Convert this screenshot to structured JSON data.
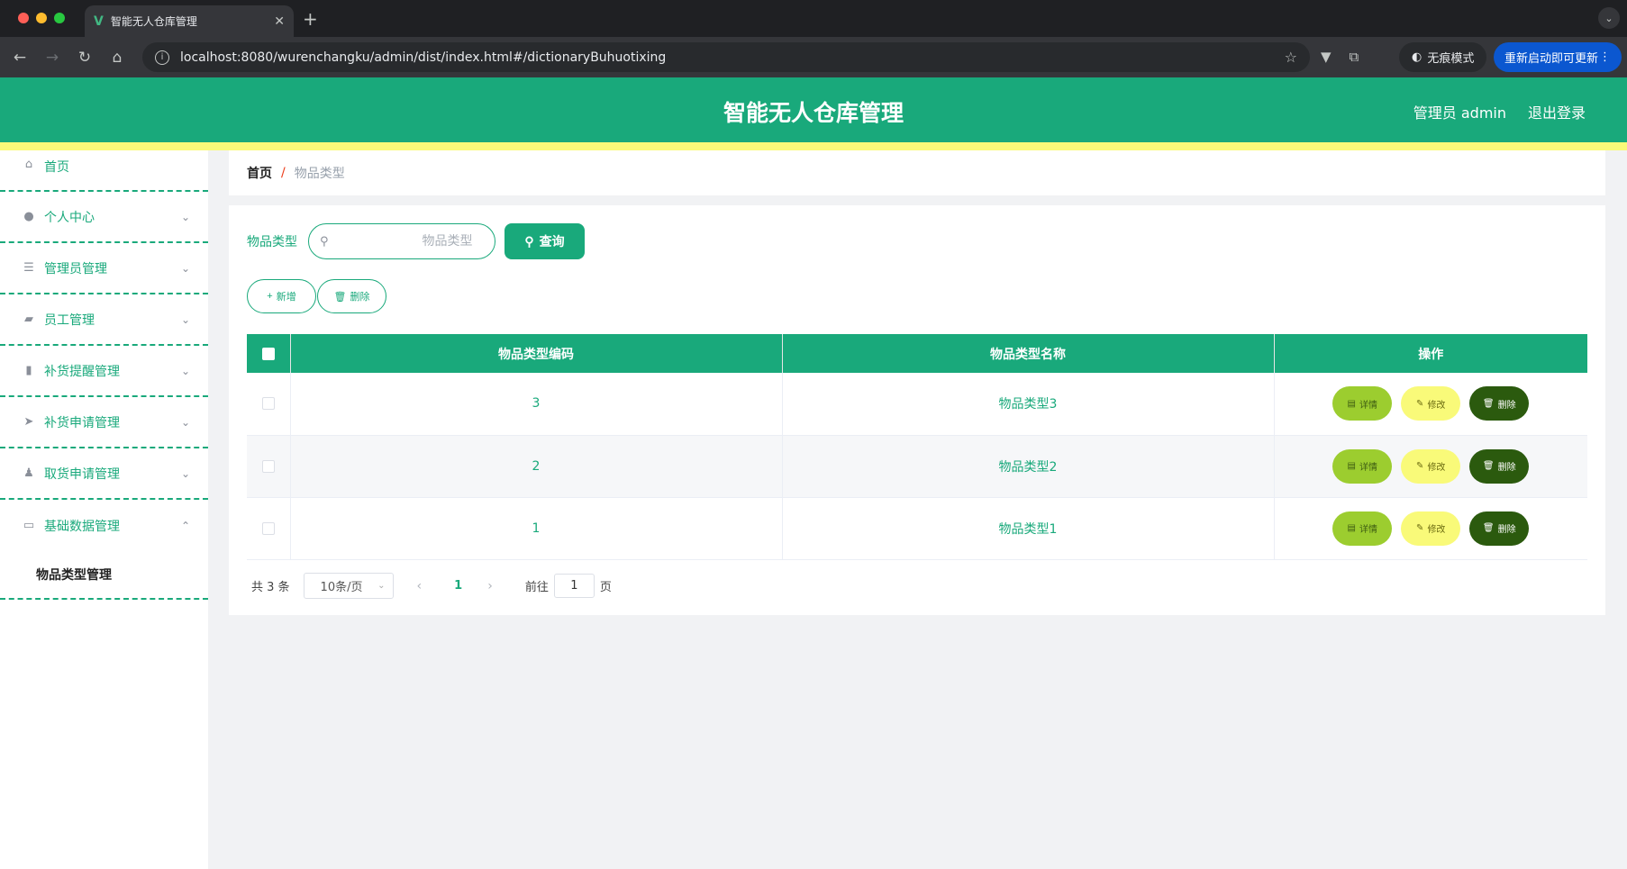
{
  "browser": {
    "tab_title": "智能无人仓库管理",
    "url": "localhost:8080/wurenchangku/admin/dist/index.html#/dictionaryBuhuotixing",
    "incognito_label": "无痕模式",
    "update_label": "重新启动即可更新"
  },
  "header": {
    "title": "智能无人仓库管理",
    "user": "管理员 admin",
    "logout": "退出登录"
  },
  "sidebar": {
    "items": [
      {
        "label": "首页",
        "icon": "home-icon"
      },
      {
        "label": "个人中心",
        "icon": "user-icon"
      },
      {
        "label": "管理员管理",
        "icon": "list-icon"
      },
      {
        "label": "员工管理",
        "icon": "briefcase-icon"
      },
      {
        "label": "补货提醒管理",
        "icon": "bar-chart-icon"
      },
      {
        "label": "补货申请管理",
        "icon": "send-icon"
      },
      {
        "label": "取货申请管理",
        "icon": "stamp-icon"
      },
      {
        "label": "基础数据管理",
        "icon": "card-icon"
      }
    ],
    "sub_item": "物品类型管理"
  },
  "breadcrumb": {
    "home": "首页",
    "separator": "/",
    "current": "物品类型"
  },
  "search": {
    "label": "物品类型",
    "placeholder": "物品类型",
    "button": "查询"
  },
  "actions": {
    "add": "新增",
    "delete": "删除"
  },
  "table": {
    "headers": [
      "物品类型编码",
      "物品类型名称",
      "操作"
    ],
    "rows": [
      {
        "code": "3",
        "name": "物品类型3"
      },
      {
        "code": "2",
        "name": "物品类型2"
      },
      {
        "code": "1",
        "name": "物品类型1"
      }
    ],
    "ops": {
      "detail": "详情",
      "edit": "修改",
      "delete": "删除"
    }
  },
  "pager": {
    "total": "共 3 条",
    "page_size": "10条/页",
    "current_page": "1",
    "goto_label": "前往",
    "goto_value": "1",
    "page_unit": "页"
  },
  "colors": {
    "primary": "#19a97b",
    "accent_yellow": "#f9fa79",
    "detail_green": "#9ccd2f",
    "delete_dark": "#2b5a0e"
  }
}
